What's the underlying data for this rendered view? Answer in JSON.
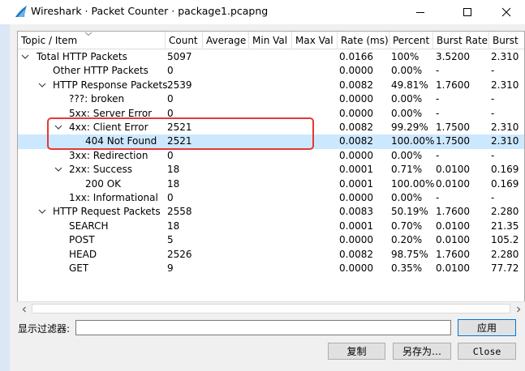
{
  "window": {
    "title": "Wireshark · Packet Counter · package1.pcapng"
  },
  "columns": [
    "Topic / Item",
    "Count",
    "Average",
    "Min Val",
    "Max Val",
    "Rate (ms)",
    "Percent",
    "Burst Rate",
    "Burst"
  ],
  "rows": [
    {
      "topic": "Total HTTP Packets",
      "count": "5097",
      "rate": "0.0166",
      "percent": "100%",
      "burst_rate": "3.5200",
      "burst": "2.310",
      "expander": "expanded",
      "indent": 0,
      "selected": false
    },
    {
      "topic": "Other HTTP Packets",
      "count": "0",
      "rate": "0.0000",
      "percent": "0.00%",
      "burst_rate": "-",
      "burst": "-",
      "expander": "none",
      "indent": 1,
      "selected": false
    },
    {
      "topic": "HTTP Response Packets",
      "count": "2539",
      "rate": "0.0082",
      "percent": "49.81%",
      "burst_rate": "1.7600",
      "burst": "2.310",
      "expander": "expanded",
      "indent": 1,
      "selected": false
    },
    {
      "topic": "???: broken",
      "count": "0",
      "rate": "0.0000",
      "percent": "0.00%",
      "burst_rate": "-",
      "burst": "-",
      "expander": "none",
      "indent": 2,
      "selected": false
    },
    {
      "topic": "5xx: Server Error",
      "count": "0",
      "rate": "0.0000",
      "percent": "0.00%",
      "burst_rate": "-",
      "burst": "-",
      "expander": "none",
      "indent": 2,
      "selected": false
    },
    {
      "topic": "4xx: Client Error",
      "count": "2521",
      "rate": "0.0082",
      "percent": "99.29%",
      "burst_rate": "1.7500",
      "burst": "2.310",
      "expander": "expanded",
      "indent": 2,
      "selected": false
    },
    {
      "topic": "404 Not Found",
      "count": "2521",
      "rate": "0.0082",
      "percent": "100.00%",
      "burst_rate": "1.7500",
      "burst": "2.310",
      "expander": "none",
      "indent": 3,
      "selected": true
    },
    {
      "topic": "3xx: Redirection",
      "count": "0",
      "rate": "0.0000",
      "percent": "0.00%",
      "burst_rate": "-",
      "burst": "-",
      "expander": "none",
      "indent": 2,
      "selected": false
    },
    {
      "topic": "2xx: Success",
      "count": "18",
      "rate": "0.0001",
      "percent": "0.71%",
      "burst_rate": "0.0100",
      "burst": "0.169",
      "expander": "expanded",
      "indent": 2,
      "selected": false
    },
    {
      "topic": "200 OK",
      "count": "18",
      "rate": "0.0001",
      "percent": "100.00%",
      "burst_rate": "0.0100",
      "burst": "0.169",
      "expander": "none",
      "indent": 3,
      "selected": false
    },
    {
      "topic": "1xx: Informational",
      "count": "0",
      "rate": "0.0000",
      "percent": "0.00%",
      "burst_rate": "-",
      "burst": "-",
      "expander": "none",
      "indent": 2,
      "selected": false
    },
    {
      "topic": "HTTP Request Packets",
      "count": "2558",
      "rate": "0.0083",
      "percent": "50.19%",
      "burst_rate": "1.7600",
      "burst": "2.280",
      "expander": "expanded",
      "indent": 1,
      "selected": false
    },
    {
      "topic": "SEARCH",
      "count": "18",
      "rate": "0.0001",
      "percent": "0.70%",
      "burst_rate": "0.0100",
      "burst": "21.35",
      "expander": "none",
      "indent": 2,
      "selected": false
    },
    {
      "topic": "POST",
      "count": "5",
      "rate": "0.0000",
      "percent": "0.20%",
      "burst_rate": "0.0100",
      "burst": "105.2",
      "expander": "none",
      "indent": 2,
      "selected": false
    },
    {
      "topic": "HEAD",
      "count": "2526",
      "rate": "0.0082",
      "percent": "98.75%",
      "burst_rate": "1.7600",
      "burst": "2.280",
      "expander": "none",
      "indent": 2,
      "selected": false
    },
    {
      "topic": "GET",
      "count": "9",
      "rate": "0.0000",
      "percent": "0.35%",
      "burst_rate": "0.0100",
      "burst": "77.72",
      "expander": "none",
      "indent": 2,
      "selected": false
    }
  ],
  "filter": {
    "label": "显示过滤器:",
    "value": "",
    "apply_label": "应用"
  },
  "buttons": {
    "copy": "复制",
    "save_as": "另存为…",
    "close": "Close"
  },
  "colors": {
    "selection": "#cce8ff",
    "highlight_box": "#e53935",
    "apply_border": "#0078d7"
  }
}
